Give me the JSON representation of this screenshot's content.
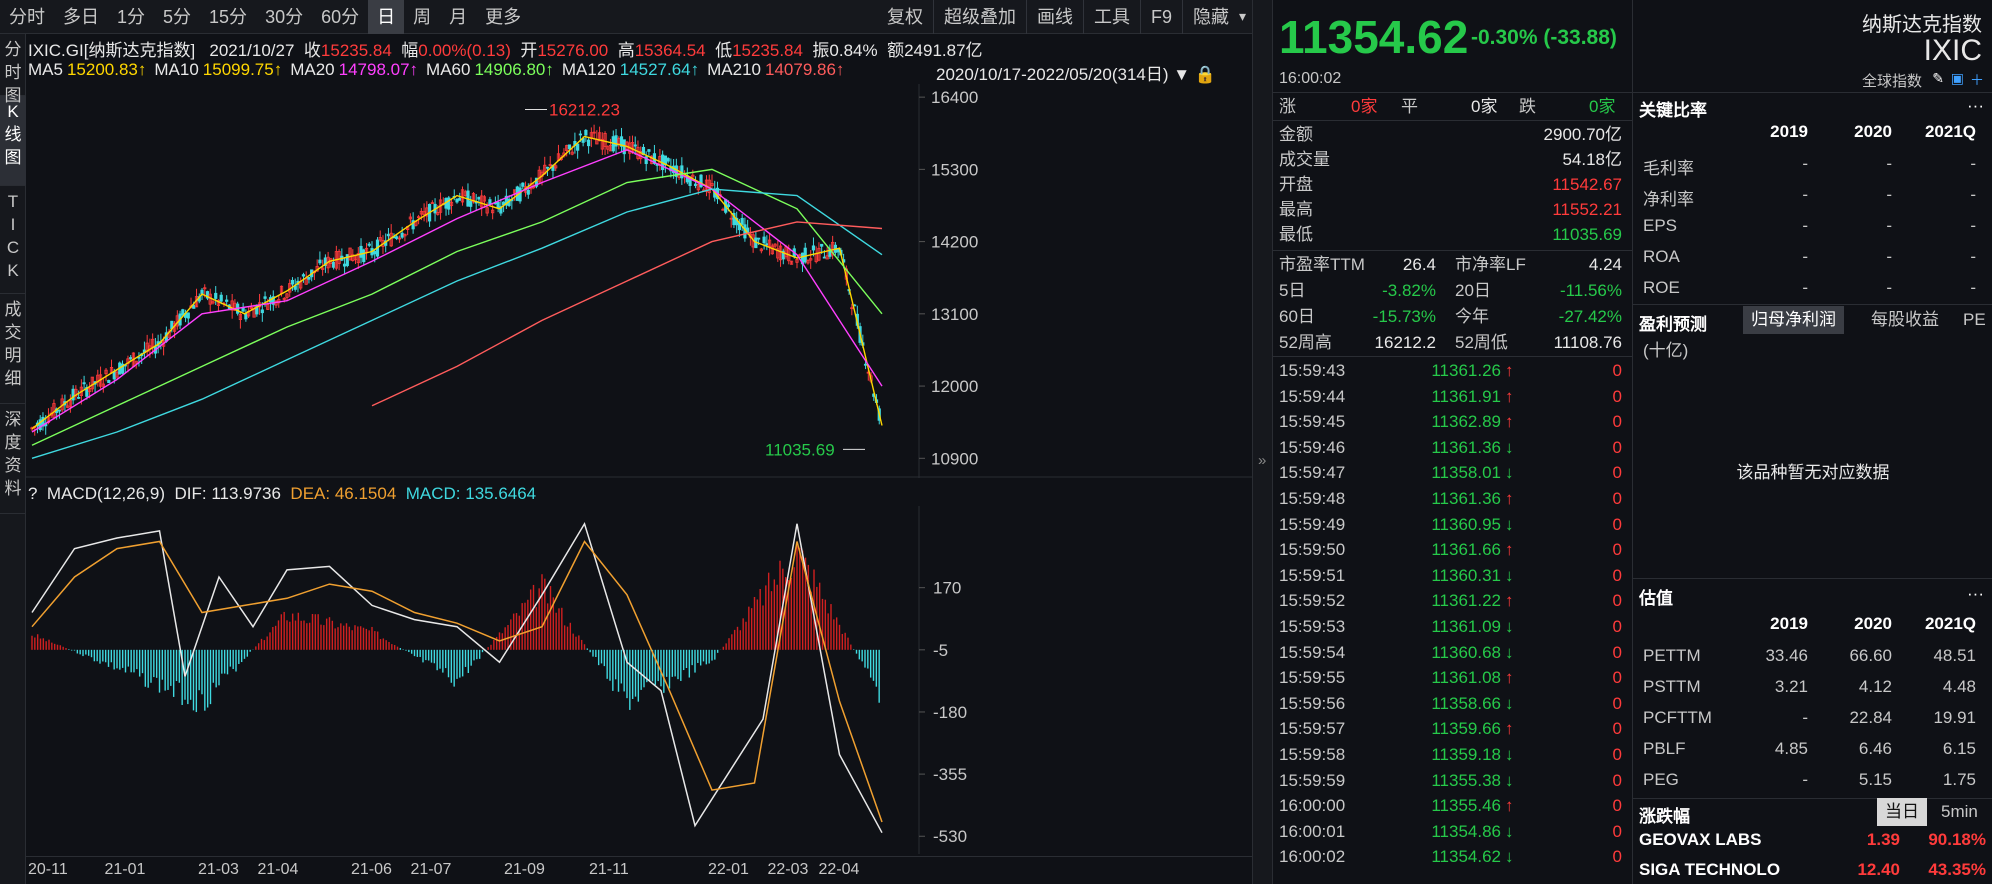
{
  "toolbar": {
    "periods": [
      "分时",
      "多日",
      "1分",
      "5分",
      "15分",
      "30分",
      "60分",
      "日",
      "周",
      "月",
      "更多"
    ],
    "active_period": "日",
    "tools": [
      "复权",
      "超级叠加",
      "画线",
      "工具",
      "F9",
      "隐藏"
    ]
  },
  "vertical_tabs": [
    "分时图",
    "K线图",
    "TICK",
    "成交明细",
    "深度资料"
  ],
  "kline_info": {
    "symbol": "IXIC.GI[纳斯达克指数]",
    "date": "2021/10/27",
    "close_label": "收",
    "close": "15235.84",
    "amp_label": "幅",
    "amp": "0.00%(0.13)",
    "open_label": "开",
    "open": "15276.00",
    "high_label": "高",
    "high": "15364.54",
    "low_label": "低",
    "low": "15235.84",
    "swing_label": "振",
    "swing": "0.84%",
    "amount_label": "额",
    "amount": "2491.87亿"
  },
  "ma_info": {
    "items": [
      {
        "label": "MA5",
        "value": "15200.83↑",
        "color": "#ffd700"
      },
      {
        "label": "MA10",
        "value": "15099.75↑",
        "color": "#ffd700"
      },
      {
        "label": "MA20",
        "value": "14798.07↑",
        "color": "#ff40ff"
      },
      {
        "label": "MA60",
        "value": "14906.80↑",
        "color": "#7cff5c"
      },
      {
        "label": "MA120",
        "value": "14527.64↑",
        "color": "#3fd9e0"
      },
      {
        "label": "MA210",
        "value": "14079.86↑",
        "color": "#ff5c5c"
      }
    ],
    "range": "2020/10/17-2022/05/20(314日)"
  },
  "macd_info": {
    "q": "?",
    "title": "MACD(12,26,9)",
    "dif": "DIF: 113.9736",
    "dea": "DEA: 46.1504",
    "macd": "MACD: 135.6464"
  },
  "chart_annotations": {
    "high": "16212.23",
    "low": "11035.69"
  },
  "x_axis_labels": [
    "20-11",
    "21-01",
    "21-03",
    "21-04",
    "21-06",
    "21-07",
    "21-09",
    "21-11",
    "22-01",
    "22-03",
    "22-04"
  ],
  "chart_data": [
    {
      "type": "line",
      "title": "IXIC.GI[纳斯达克指数]",
      "ylim": [
        10600,
        16600
      ],
      "yticks": [
        "16400",
        "15300",
        "14200",
        "13100",
        "12000",
        "10900"
      ],
      "x_labels": [
        "20-11",
        "21-01",
        "21-03",
        "21-04",
        "21-06",
        "21-07",
        "21-09",
        "21-11",
        "22-01",
        "22-03",
        "22-04"
      ],
      "series": [
        {
          "name": "MA5",
          "color": "#ffd700",
          "x": [
            0,
            5,
            10,
            15,
            20,
            25,
            30,
            35,
            40,
            45,
            50,
            55,
            60,
            65,
            70,
            75,
            80,
            85,
            90,
            95,
            100
          ],
          "values": [
            11350,
            11850,
            12250,
            12650,
            13400,
            13100,
            13450,
            13900,
            14050,
            14500,
            14900,
            14700,
            15200,
            15800,
            15650,
            15350,
            15000,
            14200,
            13950,
            14100,
            11400
          ]
        },
        {
          "name": "MA20",
          "color": "#ff40ff",
          "x": [
            0,
            10,
            20,
            30,
            40,
            50,
            60,
            70,
            80,
            90,
            100
          ],
          "values": [
            11300,
            12100,
            13100,
            13300,
            13900,
            14550,
            15100,
            15600,
            15000,
            14000,
            12000
          ]
        },
        {
          "name": "MA60",
          "color": "#7cff5c",
          "x": [
            0,
            10,
            20,
            30,
            40,
            50,
            60,
            70,
            80,
            90,
            100
          ],
          "values": [
            11100,
            11700,
            12300,
            12900,
            13400,
            14050,
            14500,
            15100,
            15300,
            14700,
            13100
          ]
        },
        {
          "name": "MA120",
          "color": "#3fd9e0",
          "x": [
            0,
            10,
            20,
            30,
            40,
            50,
            60,
            70,
            80,
            90,
            100
          ],
          "values": [
            10900,
            11300,
            11800,
            12400,
            13000,
            13600,
            14100,
            14650,
            15000,
            14900,
            14000
          ]
        },
        {
          "name": "MA210",
          "color": "#ff5c5c",
          "x": [
            40,
            50,
            60,
            70,
            80,
            90,
            100
          ],
          "values": [
            11700,
            12300,
            13000,
            13600,
            14200,
            14500,
            14400
          ]
        }
      ]
    },
    {
      "type": "line",
      "title": "MACD(12,26,9)",
      "ylim": [
        -580,
        400
      ],
      "yticks": [
        "170",
        "-5",
        "-180",
        "-355",
        "-530"
      ],
      "series": [
        {
          "name": "DIF",
          "color": "#e8e8e8",
          "x": [
            0,
            5,
            10,
            15,
            18,
            22,
            26,
            30,
            35,
            40,
            45,
            50,
            55,
            60,
            65,
            70,
            74,
            78,
            82,
            86,
            90,
            95,
            100
          ],
          "values": [
            100,
            280,
            310,
            330,
            -80,
            200,
            60,
            220,
            230,
            120,
            80,
            60,
            -40,
            150,
            350,
            -40,
            -120,
            -500,
            -350,
            -200,
            350,
            -300,
            -520
          ]
        },
        {
          "name": "DEA",
          "color": "#f0a030",
          "x": [
            0,
            5,
            10,
            15,
            20,
            25,
            30,
            35,
            40,
            45,
            50,
            55,
            60,
            65,
            70,
            75,
            80,
            85,
            90,
            95,
            100
          ],
          "values": [
            60,
            200,
            280,
            300,
            100,
            120,
            140,
            180,
            160,
            100,
            70,
            20,
            60,
            300,
            150,
            -120,
            -400,
            -380,
            300,
            -150,
            -490
          ]
        },
        {
          "name": "MACD",
          "color": "#ff3b3b",
          "x": [
            0,
            10,
            20,
            30,
            40,
            50,
            60,
            70,
            80,
            90,
            100
          ],
          "values": [
            40,
            -60,
            -160,
            100,
            50,
            -100,
            180,
            -160,
            -40,
            290,
            -150
          ]
        }
      ]
    }
  ],
  "quote": {
    "price": "11354.62",
    "change": "-0.30% (-33.88)",
    "time": "16:00:02",
    "name": "纳斯达克指数",
    "code": "IXIC",
    "index_label": "全球指数",
    "up_label": "涨",
    "up_count": "0家",
    "flat_label": "平",
    "flat_count": "0家",
    "down_label": "跌",
    "down_count": "0家",
    "rows": [
      {
        "label": "金额",
        "value": "2900.70亿",
        "color": "#e8e8e8"
      },
      {
        "label": "成交量",
        "value": "54.18亿",
        "color": "#e8e8e8"
      },
      {
        "label": "开盘",
        "value": "11542.67",
        "color": "#ff3b3b"
      },
      {
        "label": "最高",
        "value": "11552.21",
        "color": "#ff3b3b"
      },
      {
        "label": "最低",
        "value": "11035.69",
        "color": "#26c94a"
      }
    ],
    "stats": [
      {
        "l1": "市盈率TTM",
        "v1": "26.4",
        "c1": "#e8e8e8",
        "l2": "市净率LF",
        "v2": "4.24",
        "c2": "#e8e8e8"
      },
      {
        "l1": "5日",
        "v1": "-3.82%",
        "c1": "#26c94a",
        "l2": "20日",
        "v2": "-11.56%",
        "c2": "#26c94a"
      },
      {
        "l1": "60日",
        "v1": "-15.73%",
        "c1": "#26c94a",
        "l2": "今年",
        "v2": "-27.42%",
        "c2": "#26c94a"
      },
      {
        "l1": "52周高",
        "v1": "16212.2",
        "c1": "#e8e8e8",
        "l2": "52周低",
        "v2": "11108.76",
        "c2": "#e8e8e8"
      }
    ]
  },
  "ticks": [
    {
      "time": "15:59:43",
      "price": "11361.26",
      "dir": "up",
      "vol": "0"
    },
    {
      "time": "15:59:44",
      "price": "11361.91",
      "dir": "up",
      "vol": "0"
    },
    {
      "time": "15:59:45",
      "price": "11362.89",
      "dir": "up",
      "vol": "0"
    },
    {
      "time": "15:59:46",
      "price": "11361.36",
      "dir": "down",
      "vol": "0"
    },
    {
      "time": "15:59:47",
      "price": "11358.01",
      "dir": "down",
      "vol": "0"
    },
    {
      "time": "15:59:48",
      "price": "11361.36",
      "dir": "up",
      "vol": "0"
    },
    {
      "time": "15:59:49",
      "price": "11360.95",
      "dir": "down",
      "vol": "0"
    },
    {
      "time": "15:59:50",
      "price": "11361.66",
      "dir": "up",
      "vol": "0"
    },
    {
      "time": "15:59:51",
      "price": "11360.31",
      "dir": "down",
      "vol": "0"
    },
    {
      "time": "15:59:52",
      "price": "11361.22",
      "dir": "up",
      "vol": "0"
    },
    {
      "time": "15:59:53",
      "price": "11361.09",
      "dir": "down",
      "vol": "0"
    },
    {
      "time": "15:59:54",
      "price": "11360.68",
      "dir": "down",
      "vol": "0"
    },
    {
      "time": "15:59:55",
      "price": "11361.08",
      "dir": "up",
      "vol": "0"
    },
    {
      "time": "15:59:56",
      "price": "11358.66",
      "dir": "down",
      "vol": "0"
    },
    {
      "time": "15:59:57",
      "price": "11359.66",
      "dir": "up",
      "vol": "0"
    },
    {
      "time": "15:59:58",
      "price": "11359.18",
      "dir": "down",
      "vol": "0"
    },
    {
      "time": "15:59:59",
      "price": "11355.38",
      "dir": "down",
      "vol": "0"
    },
    {
      "time": "16:00:00",
      "price": "11355.46",
      "dir": "up",
      "vol": "0"
    },
    {
      "time": "16:00:01",
      "price": "11354.86",
      "dir": "down",
      "vol": "0"
    },
    {
      "time": "16:00:02",
      "price": "11354.62",
      "dir": "down",
      "vol": "0"
    }
  ],
  "ratios": {
    "title": "关键比率",
    "more": "···",
    "years": [
      "2019",
      "2020",
      "2021Q"
    ],
    "rows": [
      {
        "label": "毛利率",
        "v": [
          "-",
          "-",
          "-"
        ]
      },
      {
        "label": "净利率",
        "v": [
          "-",
          "-",
          "-"
        ]
      },
      {
        "label": "EPS",
        "v": [
          "-",
          "-",
          "-"
        ]
      },
      {
        "label": "ROA",
        "v": [
          "-",
          "-",
          "-"
        ]
      },
      {
        "label": "ROE",
        "v": [
          "-",
          "-",
          "-"
        ]
      }
    ]
  },
  "earnings": {
    "title": "盈利预测",
    "tabs": [
      "归母净利润",
      "每股收益",
      "PE"
    ],
    "unit": "(十亿)",
    "empty": "该品种暂无对应数据"
  },
  "valuation": {
    "title": "估值",
    "more": "···",
    "years": [
      "2019",
      "2020",
      "2021Q"
    ],
    "rows": [
      {
        "label": "PETTM",
        "v": [
          "33.46",
          "66.60",
          "48.51"
        ]
      },
      {
        "label": "PSTTM",
        "v": [
          "3.21",
          "4.12",
          "4.48"
        ]
      },
      {
        "label": "PCFTTM",
        "v": [
          "-",
          "22.84",
          "19.91"
        ]
      },
      {
        "label": "PBLF",
        "v": [
          "4.85",
          "6.46",
          "6.15"
        ]
      },
      {
        "label": "PEG",
        "v": [
          "-",
          "5.15",
          "1.75"
        ]
      }
    ]
  },
  "movers": {
    "title": "涨跌幅",
    "tabs": [
      "当日",
      "5min"
    ],
    "rows": [
      {
        "name": "GEOVAX LABS",
        "price": "1.39",
        "pct": "90.18%"
      },
      {
        "name": "SIGA TECHNOLO",
        "price": "12.40",
        "pct": "43.35%"
      }
    ]
  }
}
